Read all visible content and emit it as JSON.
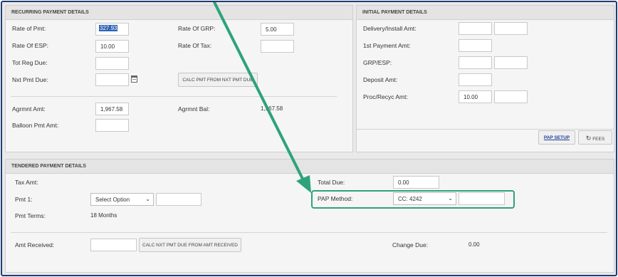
{
  "recurring": {
    "title": "RECURRING PAYMENT DETAILS",
    "rate_of_pmt_label": "Rate of Pmt:",
    "rate_of_pmt_value": "327.93",
    "rate_of_esp_label": "Rate Of ESP:",
    "rate_of_esp_value": "10.00",
    "tot_reg_due_label": "Tot Reg Due:",
    "nxt_pmt_due_label": "Nxt Pmt Due:",
    "rate_of_grp_label": "Rate Of GRP:",
    "rate_of_grp_value": "5.00",
    "rate_of_tax_label": "Rate Of Tax:",
    "calc_button": "CALC PMT FROM NXT PMT DUE",
    "agrmnt_amt_label": "Agrmnt Amt:",
    "agrmnt_amt_value": "1,967.58",
    "agrmnt_bal_label": "Agrmnt Bal:",
    "agrmnt_bal_value": "1,967.58",
    "balloon_label": "Balloon Pmt Amt:"
  },
  "initial": {
    "title": "INITIAL PAYMENT DETAILS",
    "delivery_label": "Delivery/Install Amt:",
    "first_payment_label": "1st Payment Amt:",
    "grp_esp_label": "GRP/ESP:",
    "deposit_label": "Deposit Amt:",
    "proc_label": "Proc/Recyc Amt:",
    "proc_value": "10.00",
    "pap_setup_button": "PAP SETUP",
    "fees_button": "FEES"
  },
  "tendered": {
    "title": "TENDERED PAYMENT DETAILS",
    "tax_amt_label": "Tax Amt:",
    "pmt1_label": "Pmt 1:",
    "pmt1_select": "Select Option",
    "pmt_terms_label": "Pmt Terms:",
    "pmt_terms_value": "18 Months",
    "total_due_label": "Total Due:",
    "total_due_value": "0.00",
    "pap_method_label": "PAP Method:",
    "pap_method_value": "CC: 4242",
    "amt_received_label": "Amt Received:",
    "calc_amt_button": "CALC NXT PMT DUE FROM AMT RECEIVED",
    "change_due_label": "Change Due:",
    "change_due_value": "0.00"
  },
  "colors": {
    "accent": "#2ea37a",
    "frame": "#1f3d73",
    "selection": "#2f62b3"
  },
  "icons": {
    "calendar": "calendar-icon",
    "fees": "refresh-icon",
    "dropdown": "chevron-down-icon"
  }
}
